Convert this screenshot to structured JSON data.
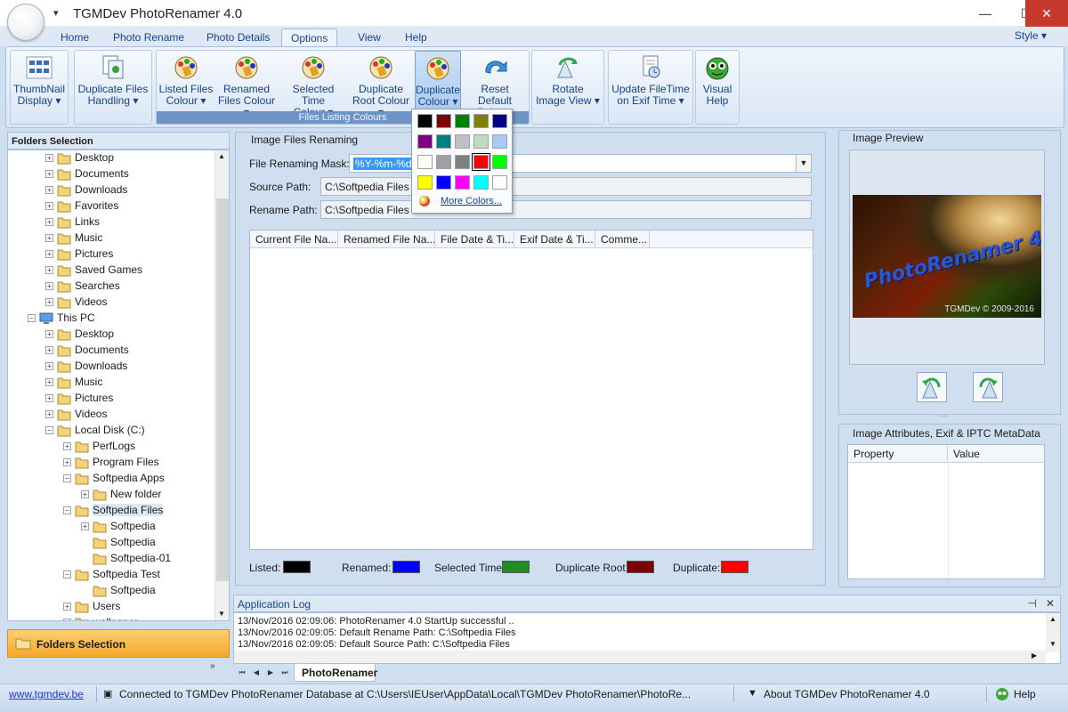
{
  "window": {
    "title": "TGMDev PhotoRenamer 4.0",
    "qat_arrow": "▾",
    "minimize": "—",
    "maximize": "☐",
    "close": "✕"
  },
  "ribbon_tabs": [
    "Home",
    "Photo Rename",
    "Photo Details",
    "Options",
    "View",
    "Help"
  ],
  "active_tab": "Options",
  "style_menu": "Style ▾",
  "ribbon_buttons": {
    "thumbnail": [
      "ThumbNail",
      "Display ▾"
    ],
    "duplicate_files": [
      "Duplicate Files",
      "Handling ▾"
    ],
    "listed_files": [
      "Listed Files",
      "Colour ▾"
    ],
    "renamed_files": [
      "Renamed",
      "Files Colour ▾"
    ],
    "selected_time": [
      "Selected Time",
      "Colour ▾"
    ],
    "duplicate_root": [
      "Duplicate",
      "Root Colour ▾"
    ],
    "duplicate_colour": [
      "Duplicate",
      "Colour ▾"
    ],
    "reset_default": [
      "Reset Default",
      "Colours"
    ],
    "rotate_image": [
      "Rotate",
      "Image View ▾"
    ],
    "update_filetime": [
      "Update FileTime",
      "on Exif Time ▾"
    ],
    "visual_help": [
      "Visual",
      "Help"
    ]
  },
  "files_listing_caption": "Files Listing Colours",
  "colour_palette": {
    "rows": [
      [
        "#000000",
        "#7f0000",
        "#008000",
        "#808000",
        "#000080"
      ],
      [
        "#800080",
        "#008080",
        "#c0c0c0",
        "#c0dcc0",
        "#a6caf0"
      ],
      [
        "#fffbf0",
        "#a0a0a4",
        "#808080",
        "#ff0000",
        "#00ff00"
      ],
      [
        "#ffff00",
        "#0000ff",
        "#ff00ff",
        "#00ffff",
        "#ffffff"
      ]
    ],
    "selected": "#ff0000",
    "more_colors": "More Colors..."
  },
  "folders": {
    "header": "Folders Selection",
    "items": [
      {
        "label": "Desktop",
        "level": 2,
        "expander": "+"
      },
      {
        "label": "Documents",
        "level": 2,
        "expander": "+"
      },
      {
        "label": "Downloads",
        "level": 2,
        "expander": "+"
      },
      {
        "label": "Favorites",
        "level": 2,
        "expander": "+"
      },
      {
        "label": "Links",
        "level": 2,
        "expander": "+"
      },
      {
        "label": "Music",
        "level": 2,
        "expander": "+"
      },
      {
        "label": "Pictures",
        "level": 2,
        "expander": "+"
      },
      {
        "label": "Saved Games",
        "level": 2,
        "expander": "+"
      },
      {
        "label": "Searches",
        "level": 2,
        "expander": "+"
      },
      {
        "label": "Videos",
        "level": 2,
        "expander": "+"
      },
      {
        "label": "This PC",
        "level": 1,
        "expander": "−"
      },
      {
        "label": "Desktop",
        "level": 2,
        "expander": "+"
      },
      {
        "label": "Documents",
        "level": 2,
        "expander": "+"
      },
      {
        "label": "Downloads",
        "level": 2,
        "expander": "+"
      },
      {
        "label": "Music",
        "level": 2,
        "expander": "+"
      },
      {
        "label": "Pictures",
        "level": 2,
        "expander": "+"
      },
      {
        "label": "Videos",
        "level": 2,
        "expander": "+"
      },
      {
        "label": "Local Disk (C:)",
        "level": 2,
        "expander": "−"
      },
      {
        "label": "PerfLogs",
        "level": 3,
        "expander": "+"
      },
      {
        "label": "Program Files",
        "level": 3,
        "expander": "+"
      },
      {
        "label": "Softpedia Apps",
        "level": 3,
        "expander": "−"
      },
      {
        "label": "New folder",
        "level": 4,
        "expander": "+"
      },
      {
        "label": "Softpedia Files",
        "level": 3,
        "expander": "−",
        "selected": true
      },
      {
        "label": "Softpedia",
        "level": 4,
        "expander": "+"
      },
      {
        "label": "Softpedia",
        "level": 4,
        "expander": ""
      },
      {
        "label": "Softpedia-01",
        "level": 4,
        "expander": ""
      },
      {
        "label": "Softpedia Test",
        "level": 3,
        "expander": "−"
      },
      {
        "label": "Softpedia",
        "level": 4,
        "expander": ""
      },
      {
        "label": "Users",
        "level": 3,
        "expander": "+"
      },
      {
        "label": "wallpaper",
        "level": 3,
        "expander": "+"
      }
    ],
    "nav_button": "Folders Selection",
    "nav_chevron": "»"
  },
  "renaming": {
    "group_title": "Image Files Renaming",
    "mask_label": "File Renaming Mask:",
    "mask_value": "%Y-%m-%d",
    "source_label": "Source Path:",
    "source_value": "C:\\Softpedia Files",
    "rename_label": "Rename Path:",
    "rename_value": "C:\\Softpedia Files",
    "columns": [
      "Current File Na...",
      "Renamed File Na...",
      "File Date & Ti...",
      "Exif Date & Ti...",
      "Comme..."
    ],
    "legend": [
      {
        "label": "Listed:",
        "color": "#000000"
      },
      {
        "label": "Renamed:",
        "color": "#0000ff"
      },
      {
        "label": "Selected Time:",
        "color": "#228b22"
      },
      {
        "label": "Duplicate Root:",
        "color": "#7f0000"
      },
      {
        "label": "Duplicate:",
        "color": "#ff0000"
      }
    ]
  },
  "preview": {
    "title": "Image Preview",
    "image_title": "PhotoRenamer 4.0",
    "image_copyright": "TGMDev © 2009-2016",
    "divider": "....",
    "attrs_title": "Image Attributes, Exif & IPTC MetaData",
    "attrs_columns": [
      "Property",
      "Value"
    ]
  },
  "log": {
    "title": "Application Log",
    "pin": "⊣",
    "close": "✕",
    "lines": [
      "13/Nov/2016 02:09:06: PhotoRenamer 4.0 StartUp successful ..",
      "13/Nov/2016 02:09:05: Default Rename Path: C:\\Softpedia Files",
      "13/Nov/2016 02:09:05: Default Source Path: C:\\Softpedia Files"
    ],
    "doc_tab": "PhotoRenamer"
  },
  "status": {
    "link": "www.tgmdev.be",
    "db": "Connected to TGMDev PhotoRenamer Database at C:\\Users\\IEUser\\AppData\\Local\\TGMDev PhotoRenamer\\PhotoRe...",
    "about": "About TGMDev PhotoRenamer 4.0",
    "help": "Help"
  },
  "colors": {
    "ribbon_text": "#15428b",
    "accent_orange": "#f4a72b",
    "panel_bg": "#cfdff0"
  }
}
